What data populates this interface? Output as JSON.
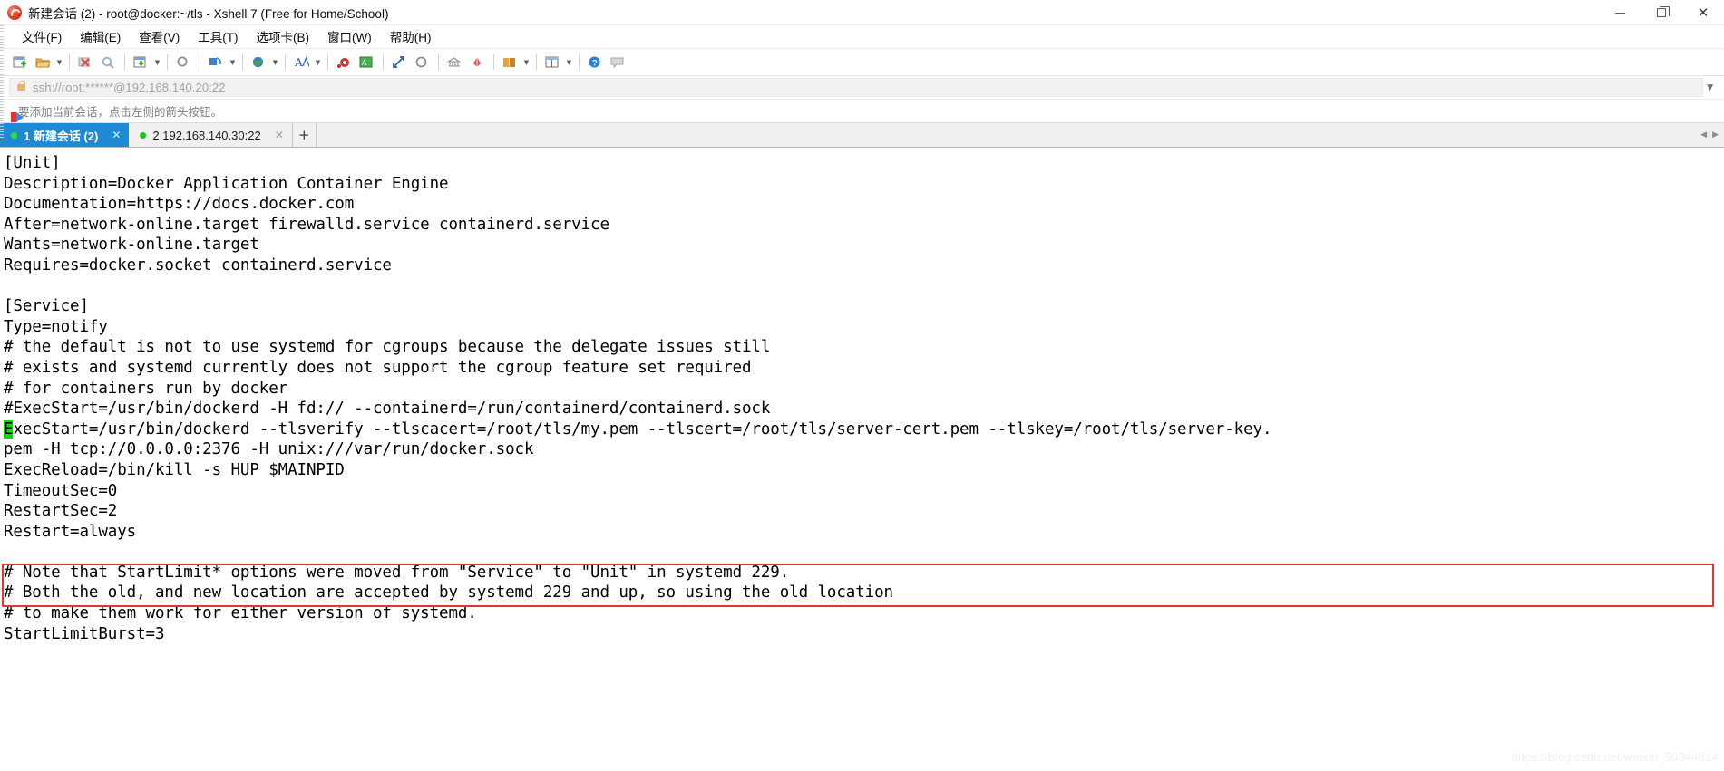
{
  "window": {
    "title": "新建会话 (2) - root@docker:~/tls - Xshell 7 (Free for Home/School)",
    "logo_icon": "xshell-logo-icon",
    "minimize_label": "最小化",
    "maximize_label": "最大化",
    "close_label": "关闭"
  },
  "menu": {
    "items": [
      {
        "label": "文件(F)",
        "name": "menu-file"
      },
      {
        "label": "编辑(E)",
        "name": "menu-edit"
      },
      {
        "label": "查看(V)",
        "name": "menu-view"
      },
      {
        "label": "工具(T)",
        "name": "menu-tools"
      },
      {
        "label": "选项卡(B)",
        "name": "menu-tabs"
      },
      {
        "label": "窗口(W)",
        "name": "menu-window"
      },
      {
        "label": "帮助(H)",
        "name": "menu-help"
      }
    ]
  },
  "toolbar": {
    "buttons": [
      {
        "name": "new-session-icon",
        "glyph": "new"
      },
      {
        "name": "open-session-icon",
        "glyph": "folder",
        "caret": true
      },
      {
        "name": "disconnect-icon",
        "glyph": "disconnect"
      },
      {
        "name": "reconnect-icon",
        "glyph": "reconnect"
      },
      {
        "name": "save-session-icon",
        "glyph": "save",
        "caret": true
      },
      {
        "name": "find-icon",
        "glyph": "find"
      },
      {
        "name": "copy-paste-icon",
        "glyph": "clipboard",
        "caret": true
      },
      {
        "name": "globe-transfer-icon",
        "glyph": "globe",
        "caret": true
      },
      {
        "name": "font-size-icon",
        "glyph": "font",
        "caret": true
      },
      {
        "name": "record-icon",
        "glyph": "record"
      },
      {
        "name": "log-icon",
        "glyph": "log"
      },
      {
        "name": "fullscreen-icon",
        "glyph": "fullscreen"
      },
      {
        "name": "sync-icon",
        "glyph": "sync"
      },
      {
        "name": "tunnel-icon",
        "glyph": "tunnel"
      },
      {
        "name": "key-agent-icon",
        "glyph": "key"
      },
      {
        "name": "properties-icon",
        "glyph": "props",
        "caret": true
      },
      {
        "name": "layout-icon",
        "glyph": "layout",
        "caret": true
      },
      {
        "name": "help-icon",
        "glyph": "help"
      },
      {
        "name": "chat-icon",
        "glyph": "chat"
      }
    ]
  },
  "address_bar": {
    "lock_icon": "lock-icon",
    "value": "ssh://root:******@192.168.140.20:22",
    "placeholder": "ssh://root:******@192.168.140.20:22",
    "chevron_icon": "chevron-down-icon"
  },
  "notice_bar": {
    "icon": "arrow-bookmark-icon",
    "text": "要添加当前会话，点击左侧的箭头按钮。"
  },
  "tabs": {
    "items": [
      {
        "name": "tab-session-1",
        "index": "1",
        "label": "新建会话 (2)",
        "full_label": "1 新建会话 (2)",
        "active": true,
        "status_color": "#2fdf2f",
        "close_icon": "close-icon"
      },
      {
        "name": "tab-session-2",
        "index": "2",
        "label": "192.168.140.30:22",
        "full_label": "2 192.168.140.30:22",
        "active": false,
        "status_color": "#19c419",
        "close_icon": "close-icon"
      }
    ],
    "new_tab_label": "+",
    "scroll_left_icon": "chevron-left-icon",
    "scroll_right_icon": "chevron-right-icon"
  },
  "terminal": {
    "cursor_char": "E",
    "cursor_color": "#00e000",
    "highlight_color": "#e8342a",
    "watermark": "https://blog.csdn.net/weixin_50344814",
    "lines": [
      "[Unit]",
      "Description=Docker Application Container Engine",
      "Documentation=https://docs.docker.com",
      "After=network-online.target firewalld.service containerd.service",
      "Wants=network-online.target",
      "Requires=docker.socket containerd.service",
      "",
      "[Service]",
      "Type=notify",
      "# the default is not to use systemd for cgroups because the delegate issues still",
      "# exists and systemd currently does not support the cgroup feature set required",
      "# for containers run by docker",
      "#ExecStart=/usr/bin/dockerd -H fd:// --containerd=/run/containerd/containerd.sock",
      "ExecStart=/usr/bin/dockerd --tlsverify --tlscacert=/root/tls/my.pem --tlscert=/root/tls/server-cert.pem --tlskey=/root/tls/server-key.",
      "pem -H tcp://0.0.0.0:2376 -H unix:///var/run/docker.sock",
      "ExecReload=/bin/kill -s HUP $MAINPID",
      "TimeoutSec=0",
      "RestartSec=2",
      "Restart=always",
      "",
      "# Note that StartLimit* options were moved from \"Service\" to \"Unit\" in systemd 229.",
      "# Both the old, and new location are accepted by systemd 229 and up, so using the old location",
      "# to make them work for either version of systemd.",
      "StartLimitBurst=3"
    ],
    "highlighted_line_indices": [
      13,
      14
    ]
  }
}
